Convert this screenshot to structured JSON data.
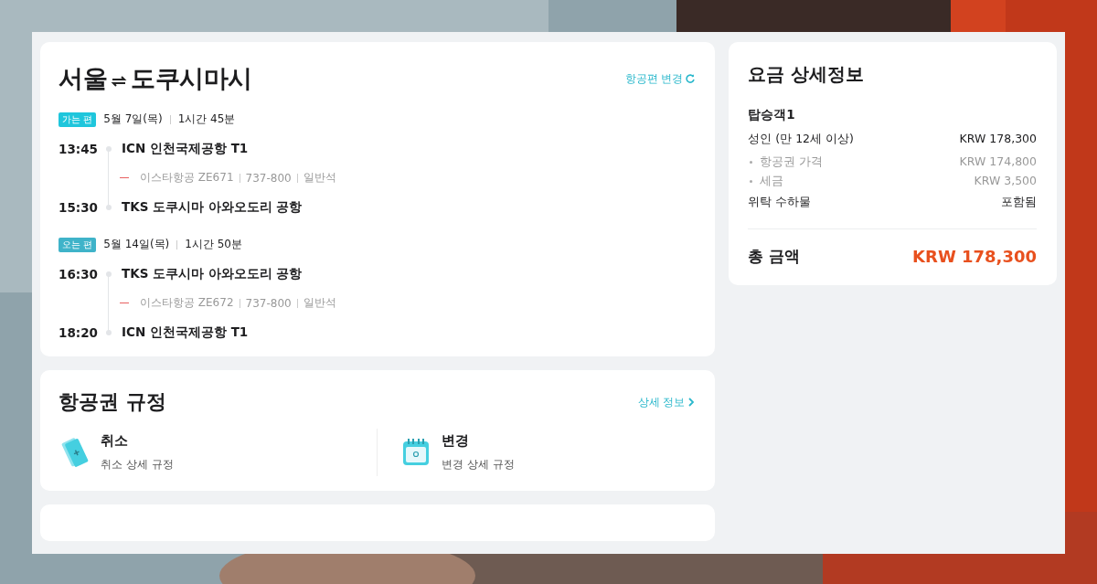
{
  "itinerary": {
    "origin": "서울",
    "destination": "도쿠시마시",
    "change_link": "항공편 변경",
    "legs": [
      {
        "badge": "가는 편",
        "color": "#1fc6dc",
        "date": "5월 7일(목)",
        "duration": "1시간 45분",
        "departure": {
          "time": "13:45",
          "airport": "ICN 인천국제공항 T1"
        },
        "airline": "이스타항공 ZE671",
        "aircraft": "737-800",
        "cabin": "일반석",
        "arrival": {
          "time": "15:30",
          "airport": "TKS 도쿠시마 아와오도리 공항"
        }
      },
      {
        "badge": "오는 편",
        "color": "#3fb3c9",
        "date": "5월 14일(목)",
        "duration": "1시간 50분",
        "departure": {
          "time": "16:30",
          "airport": "TKS 도쿠시마 아와오도리 공항"
        },
        "airline": "이스타항공 ZE672",
        "aircraft": "737-800",
        "cabin": "일반석",
        "arrival": {
          "time": "18:20",
          "airport": "ICN 인천국제공항 T1"
        }
      }
    ]
  },
  "rules": {
    "title": "항공권 규정",
    "link": "상세 정보",
    "items": [
      {
        "kind": "ticket",
        "title": "취소",
        "subtitle": "취소 상세 규정"
      },
      {
        "kind": "calendar",
        "title": "변경",
        "subtitle": "변경 상세 규정"
      }
    ]
  },
  "fare": {
    "title": "요금 상세정보",
    "passenger": "탑승객1",
    "rows": [
      {
        "kind": "main",
        "label": "성인 (만 12세 이상)",
        "value": "KRW 178,300"
      },
      {
        "kind": "sub",
        "label": "항공권 가격",
        "value": "KRW 174,800"
      },
      {
        "kind": "sub",
        "label": "세금",
        "value": "KRW 3,500"
      },
      {
        "kind": "main",
        "label": "위탁 수하물",
        "value": "포함됨"
      }
    ],
    "total_label": "총 금액",
    "total_value": "KRW 178,300"
  }
}
